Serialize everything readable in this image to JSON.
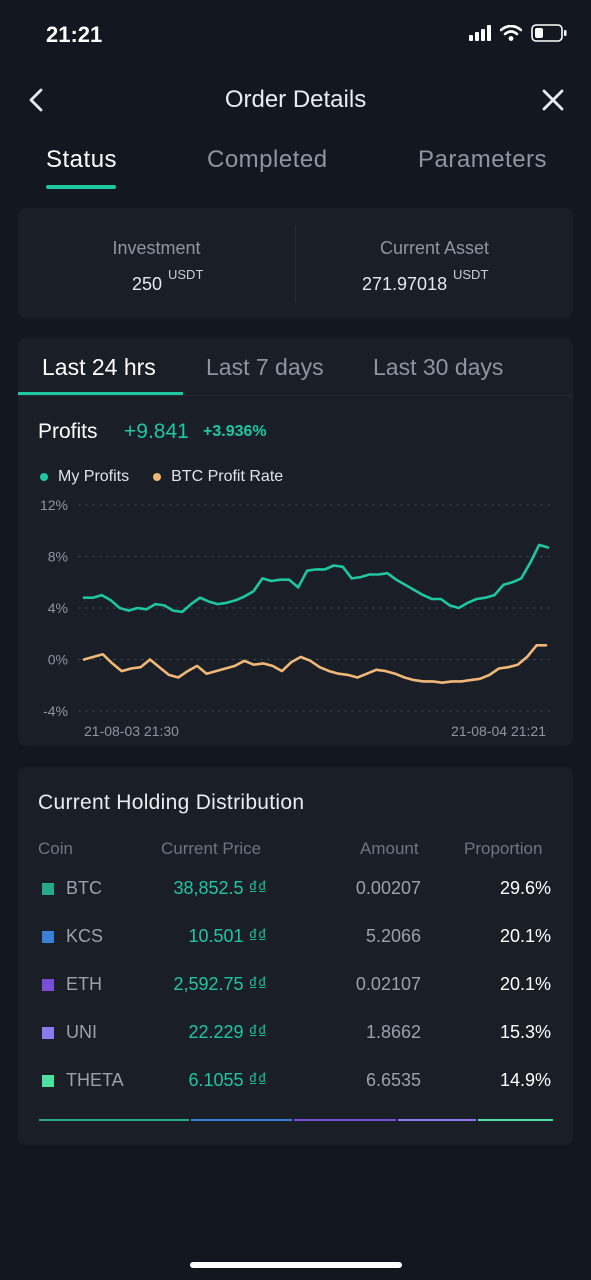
{
  "status_bar": {
    "time": "21:21"
  },
  "header": {
    "title": "Order Details"
  },
  "tabs": [
    {
      "label": "Status",
      "active": true
    },
    {
      "label": "Completed",
      "active": false
    },
    {
      "label": "Parameters",
      "active": false
    }
  ],
  "investment": {
    "investment_label": "Investment",
    "investment_value": "250",
    "investment_unit": "USDT",
    "asset_label": "Current Asset",
    "asset_value": "271.97018",
    "asset_unit": "USDT"
  },
  "range_tabs": [
    {
      "label": "Last 24 hrs",
      "active": true
    },
    {
      "label": "Last 7 days",
      "active": false
    },
    {
      "label": "Last 30 days",
      "active": false
    }
  ],
  "profits": {
    "label": "Profits",
    "value": "+9.841",
    "percent": "+3.936%"
  },
  "colors": {
    "accent": "#1ec7a0",
    "btc_line": "#f0b878",
    "background": "#131820",
    "card": "#1a1f27"
  },
  "chart_data": {
    "type": "line",
    "legend": "top-left",
    "grid": true,
    "ylim": [
      -4,
      12
    ],
    "yticks": [
      "12%",
      "8%",
      "4%",
      "0%",
      "-4%"
    ],
    "x_tick_labels": [
      "21-08-03 21:30",
      "21-08-04 21:21"
    ],
    "series": [
      {
        "name": "My Profits",
        "color": "#1ec7a0",
        "values": [
          4.8,
          4.8,
          5.0,
          4.6,
          4.0,
          3.8,
          4.0,
          3.9,
          4.3,
          4.2,
          3.8,
          3.7,
          4.3,
          4.8,
          4.5,
          4.3,
          4.4,
          4.6,
          4.9,
          5.3,
          6.3,
          6.1,
          6.2,
          6.2,
          5.6,
          6.9,
          7.0,
          7.0,
          7.3,
          7.2,
          6.3,
          6.4,
          6.6,
          6.6,
          6.7,
          6.2,
          5.8,
          5.4,
          5.0,
          4.7,
          4.7,
          4.2,
          4.0,
          4.4,
          4.7,
          4.8,
          5.0,
          5.8,
          6.0,
          6.3,
          7.5,
          8.9,
          8.7
        ]
      },
      {
        "name": "BTC Profit Rate",
        "color": "#f0b878",
        "values": [
          0.0,
          0.2,
          0.4,
          -0.3,
          -0.9,
          -0.7,
          -0.6,
          0.0,
          -0.6,
          -1.2,
          -1.4,
          -0.9,
          -0.5,
          -1.1,
          -0.9,
          -0.7,
          -0.5,
          -0.1,
          -0.4,
          -0.3,
          -0.5,
          -0.9,
          -0.2,
          0.2,
          -0.1,
          -0.6,
          -0.9,
          -1.1,
          -1.2,
          -1.4,
          -1.1,
          -0.8,
          -0.9,
          -1.1,
          -1.4,
          -1.6,
          -1.7,
          -1.7,
          -1.8,
          -1.7,
          -1.7,
          -1.6,
          -1.5,
          -1.2,
          -0.7,
          -0.6,
          -0.4,
          0.2,
          1.1,
          1.1
        ]
      }
    ]
  },
  "holdings": {
    "title": "Current Holding Distribution",
    "headers": {
      "coin": "Coin",
      "price": "Current Price",
      "amount": "Amount",
      "proportion": "Proportion"
    },
    "rows": [
      {
        "coin": "BTC",
        "price": "38,852.5 ₫₫",
        "amount": "0.00207",
        "proportion": "29.6%",
        "color": "#26a88a",
        "share": 29.6
      },
      {
        "coin": "KCS",
        "price": "10.501 ₫₫",
        "amount": "5.2066",
        "proportion": "20.1%",
        "color": "#3b7fd9",
        "share": 20.1
      },
      {
        "coin": "ETH",
        "price": "2,592.75 ₫₫",
        "amount": "0.02107",
        "proportion": "20.1%",
        "color": "#7a4fd6",
        "share": 20.1
      },
      {
        "coin": "UNI",
        "price": "22.229 ₫₫",
        "amount": "1.8662",
        "proportion": "15.3%",
        "color": "#8c79f0",
        "share": 15.3
      },
      {
        "coin": "THETA",
        "price": "6.1055 ₫₫",
        "amount": "6.6535",
        "proportion": "14.9%",
        "color": "#4ee0a0",
        "share": 14.9
      }
    ]
  }
}
